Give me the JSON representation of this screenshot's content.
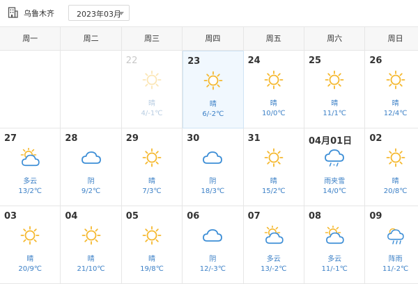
{
  "header": {
    "city_icon": "building-icon",
    "city": "乌鲁木齐",
    "month_value": "2023年03月",
    "month_caret_icon": "chevron-down-icon"
  },
  "weekdays": [
    "周一",
    "周二",
    "周三",
    "周四",
    "周五",
    "周六",
    "周日"
  ],
  "colors": {
    "sun": "#f5b82e",
    "cloud": "#3d8ed6",
    "text_blue": "#3a7fc6",
    "today_bg": "#f1f8fe"
  },
  "weeks": [
    [
      {
        "date": "",
        "desc": "",
        "temp": "",
        "icon": ""
      },
      {
        "date": "",
        "desc": "",
        "temp": "",
        "icon": ""
      },
      {
        "date": "22",
        "desc": "晴",
        "temp": "4/-1℃",
        "icon": "sun-icon",
        "past": true
      },
      {
        "date": "23",
        "desc": "晴",
        "temp": "6/-2℃",
        "icon": "sun-icon",
        "today": true
      },
      {
        "date": "24",
        "desc": "晴",
        "temp": "10/0℃",
        "icon": "sun-icon"
      },
      {
        "date": "25",
        "desc": "晴",
        "temp": "11/1℃",
        "icon": "sun-icon"
      },
      {
        "date": "26",
        "desc": "晴",
        "temp": "12/4℃",
        "icon": "sun-icon"
      }
    ],
    [
      {
        "date": "27",
        "desc": "多云",
        "temp": "13/2℃",
        "icon": "partly-cloudy-icon"
      },
      {
        "date": "28",
        "desc": "阴",
        "temp": "9/2℃",
        "icon": "cloud-icon"
      },
      {
        "date": "29",
        "desc": "晴",
        "temp": "7/3℃",
        "icon": "sun-icon"
      },
      {
        "date": "30",
        "desc": "阴",
        "temp": "18/3℃",
        "icon": "cloud-icon"
      },
      {
        "date": "31",
        "desc": "晴",
        "temp": "15/2℃",
        "icon": "sun-icon"
      },
      {
        "date": "04月01日",
        "desc": "雨夹雪",
        "temp": "14/0℃",
        "icon": "sleet-icon"
      },
      {
        "date": "02",
        "desc": "晴",
        "temp": "20/8℃",
        "icon": "sun-icon"
      }
    ],
    [
      {
        "date": "03",
        "desc": "晴",
        "temp": "20/9℃",
        "icon": "sun-icon"
      },
      {
        "date": "04",
        "desc": "晴",
        "temp": "21/10℃",
        "icon": "sun-icon"
      },
      {
        "date": "05",
        "desc": "晴",
        "temp": "19/8℃",
        "icon": "sun-icon"
      },
      {
        "date": "06",
        "desc": "阴",
        "temp": "12/-3℃",
        "icon": "cloud-icon"
      },
      {
        "date": "07",
        "desc": "多云",
        "temp": "13/-2℃",
        "icon": "partly-cloudy-icon"
      },
      {
        "date": "08",
        "desc": "多云",
        "temp": "11/-1℃",
        "icon": "partly-cloudy-icon"
      },
      {
        "date": "09",
        "desc": "阵雨",
        "temp": "11/-2℃",
        "icon": "shower-icon"
      }
    ]
  ]
}
